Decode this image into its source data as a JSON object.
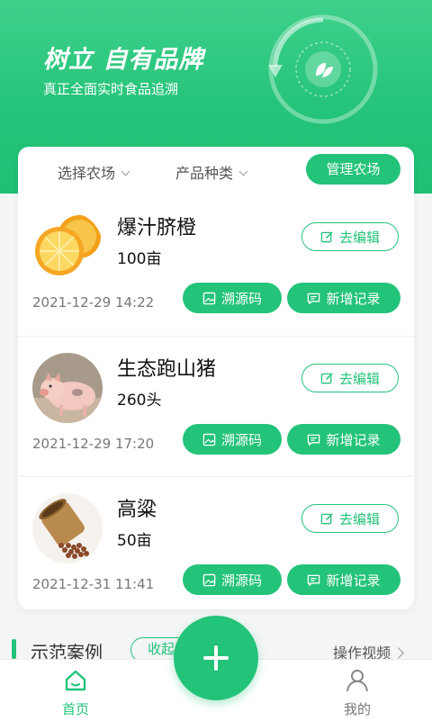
{
  "hero": {
    "title": "树立 自有品牌",
    "subtitle": "真正全面实时食品追溯",
    "icon": "leaf-icon"
  },
  "filters": {
    "farm": "选择农场",
    "category": "产品种类",
    "manage_button": "管理农场"
  },
  "products": [
    {
      "name": "爆汁脐橙",
      "quantity": "100亩",
      "date": "2021-12-29 14:22",
      "image": "orange-photo"
    },
    {
      "name": "生态跑山猪",
      "quantity": "260头",
      "date": "2021-12-29 17:20",
      "image": "piglet-photo"
    },
    {
      "name": "高粱",
      "quantity": "50亩",
      "date": "2021-12-31 11:41",
      "image": "sorghum-photo"
    }
  ],
  "actions": {
    "edit": "去编辑",
    "trace": "溯源码",
    "record": "新增记录"
  },
  "demo": {
    "title": "示范案例",
    "collapse": "收起",
    "video": "操作视频"
  },
  "tabbar": {
    "home": "首页",
    "me": "我的"
  },
  "colors": {
    "accent": "#23c379",
    "hero_top": "#3fd08a"
  }
}
